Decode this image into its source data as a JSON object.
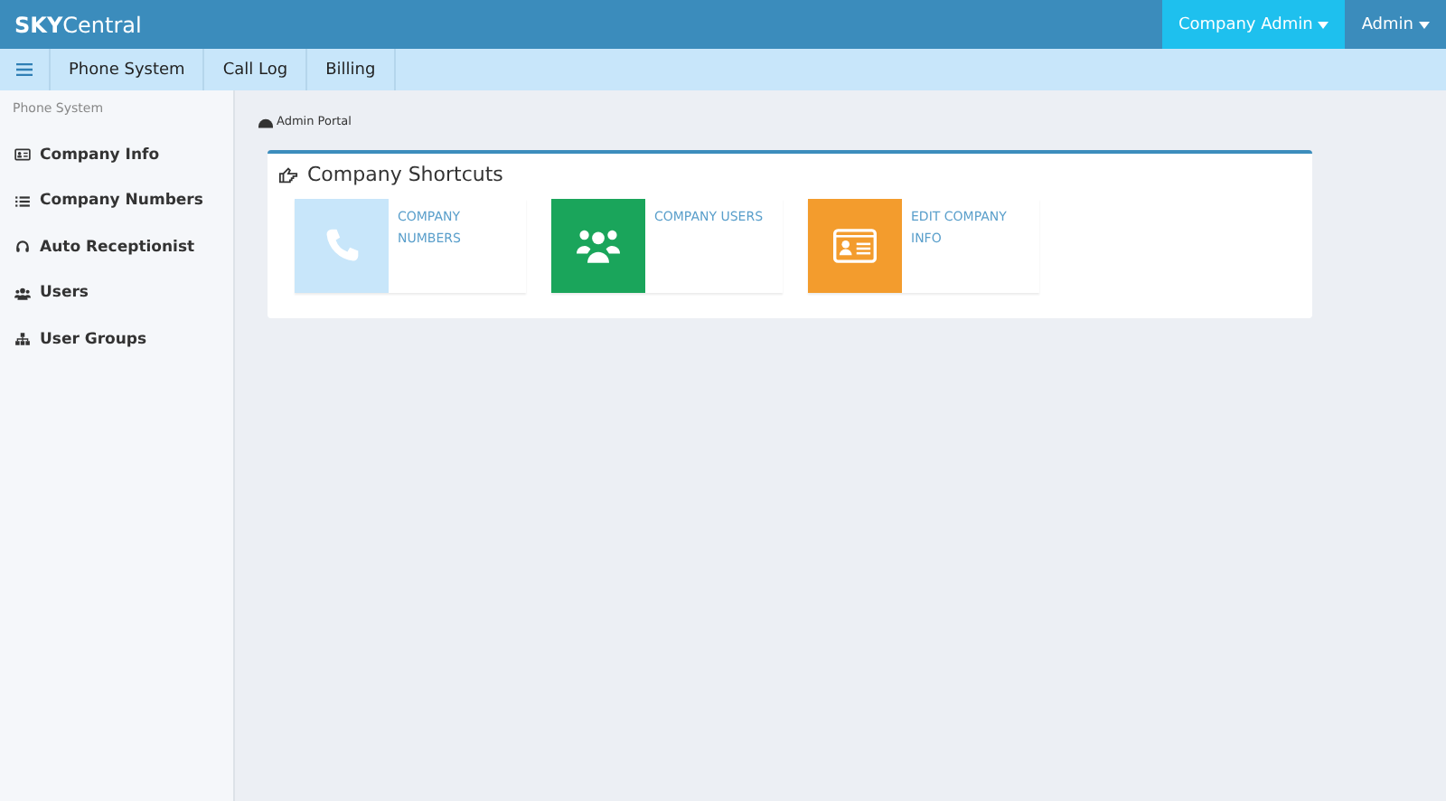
{
  "brand": {
    "bold": "SKY",
    "rest": "Central"
  },
  "top_menus": [
    {
      "label": "Company Admin",
      "selected": true
    },
    {
      "label": "Admin",
      "selected": false
    }
  ],
  "nav_tabs": [
    "Phone System",
    "Call Log",
    "Billing"
  ],
  "sidebar": {
    "heading": "Phone System",
    "items": [
      {
        "label": "Company Info",
        "kind": "card"
      },
      {
        "label": "Company Numbers",
        "kind": "list"
      },
      {
        "label": "Auto Receptionist",
        "kind": "headset"
      },
      {
        "label": "Users",
        "kind": "users"
      },
      {
        "label": "User Groups",
        "kind": "sitemap"
      }
    ]
  },
  "breadcrumb": "Admin Portal",
  "panel": {
    "title": "Company Shortcuts",
    "shortcuts": [
      {
        "label": "COMPANY NUMBERS",
        "kind": "phone",
        "color": "#c8e6fa"
      },
      {
        "label": "COMPANY USERS",
        "kind": "users",
        "color": "#1aa55b"
      },
      {
        "label": "EDIT COMPANY INFO",
        "kind": "idcard",
        "color": "#f39c2d"
      }
    ]
  }
}
